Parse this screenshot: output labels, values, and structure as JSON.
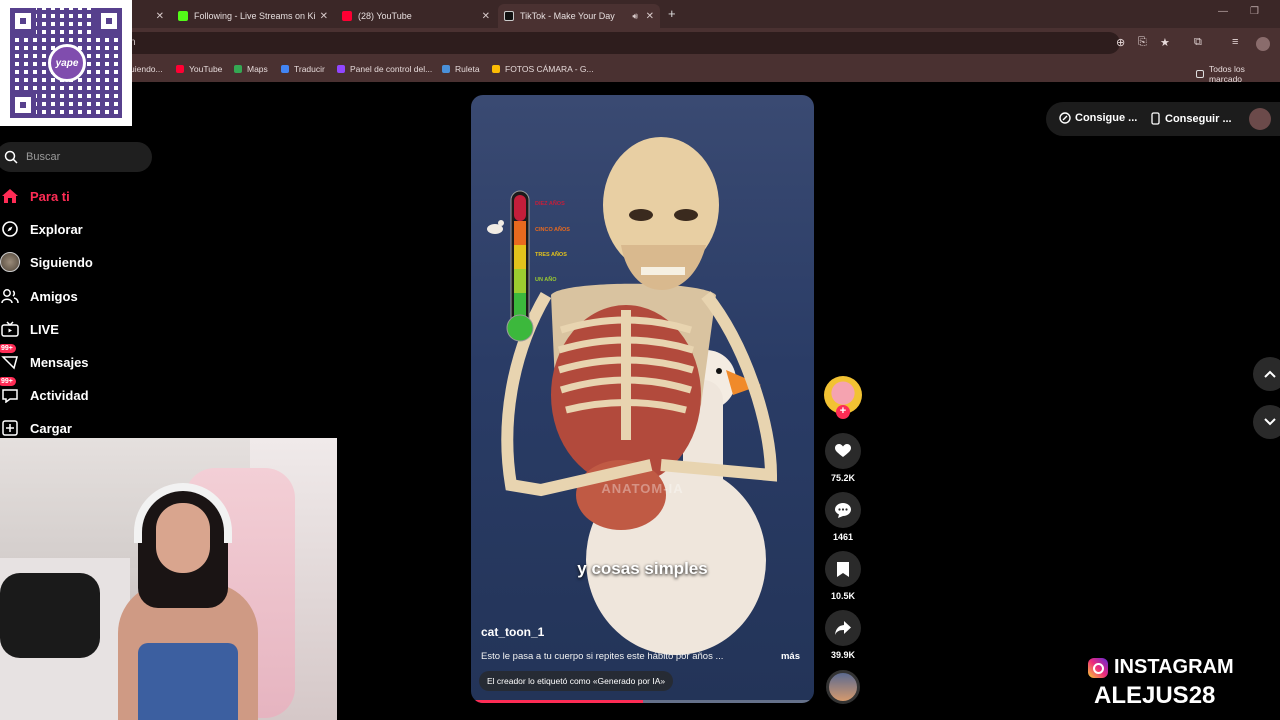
{
  "browser": {
    "tabs": [
      {
        "label": "Following - Live Streams on Ki",
        "color": "#53fc18"
      },
      {
        "label": "(28) YouTube",
        "color": "#ff0033"
      },
      {
        "label": "TikTok - Make Your Day",
        "color": "#111111"
      }
    ],
    "omnibox_text": "n",
    "bookmarks": [
      {
        "label": "uiendo...",
        "color": "#888888"
      },
      {
        "label": "YouTube",
        "color": "#ff0033"
      },
      {
        "label": "Maps",
        "color": "#34a853"
      },
      {
        "label": "Traducir",
        "color": "#4285f4"
      },
      {
        "label": "Panel de control del...",
        "color": "#9146ff"
      },
      {
        "label": "Ruleta",
        "color": "#4a90d9"
      },
      {
        "label": "FOTOS CÁMARA - G...",
        "color": "#fbbc04"
      }
    ],
    "all_bookmarks": "Todos los marcado"
  },
  "qr": {
    "logo_text": "yape"
  },
  "sidebar": {
    "search_placeholder": "Buscar",
    "items": [
      {
        "label": "Para ti",
        "icon": "home-icon"
      },
      {
        "label": "Explorar",
        "icon": "compass-icon"
      },
      {
        "label": "Siguiendo",
        "icon": "following-avatar-icon"
      },
      {
        "label": "Amigos",
        "icon": "friends-icon"
      },
      {
        "label": "LIVE",
        "icon": "live-tv-icon"
      },
      {
        "label": "Mensajes",
        "icon": "messages-icon",
        "badge": "99+"
      },
      {
        "label": "Actividad",
        "icon": "activity-icon",
        "badge": "99+"
      },
      {
        "label": "Cargar",
        "icon": "upload-icon"
      }
    ]
  },
  "video": {
    "caption": "y cosas simples",
    "watermark": "ANATOM-IA",
    "thermometer_labels": [
      "DIEZ AÑOS",
      "CINCO AÑOS",
      "TRES AÑOS",
      "UN AÑO"
    ],
    "author": "cat_toon_1",
    "description": "Esto le pasa a tu cuerpo si repites este hábito por años ...",
    "more": "más",
    "ai_label": "El creador lo etiquetó como «Generado por IA»",
    "progress": 0.5
  },
  "actions": {
    "likes": "75.2K",
    "comments": "1461",
    "saves": "10.5K",
    "shares": "39.9K"
  },
  "topright": {
    "get_coins": "Consigue ...",
    "get_app": "Conseguir ..."
  },
  "overlay": {
    "instagram": "INSTAGRAM",
    "handle": "ALEJUS28"
  }
}
